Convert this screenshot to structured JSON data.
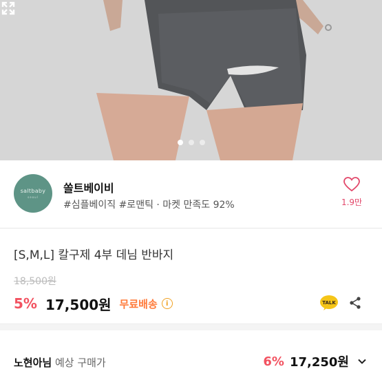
{
  "product_photo": {
    "slide_count": 3,
    "active_slide": 1
  },
  "store": {
    "logo_text": "saltbaby",
    "logo_subtext": "seoul",
    "name": "쏠트베이비",
    "tags": "#심플베이직 #로맨틱 · 마켓 만족도 92%",
    "like_count": "1.9만"
  },
  "product": {
    "title": "[S,M,L] 칼구제 4부 데님 반바지",
    "original_price": "18,500원",
    "discount": "5%",
    "price": "17,500원",
    "shipping": "무료배송",
    "info_symbol": "i",
    "talk_label": "TALK"
  },
  "expected_price": {
    "user_name": "노현아님",
    "label": "예상 구매가",
    "discount": "6%",
    "price": "17,250원"
  },
  "colors": {
    "accent_pink": "#f25260",
    "shipping_orange": "#ff7a3a",
    "logo_green": "#5e9486",
    "talk_yellow": "#f5c518"
  }
}
